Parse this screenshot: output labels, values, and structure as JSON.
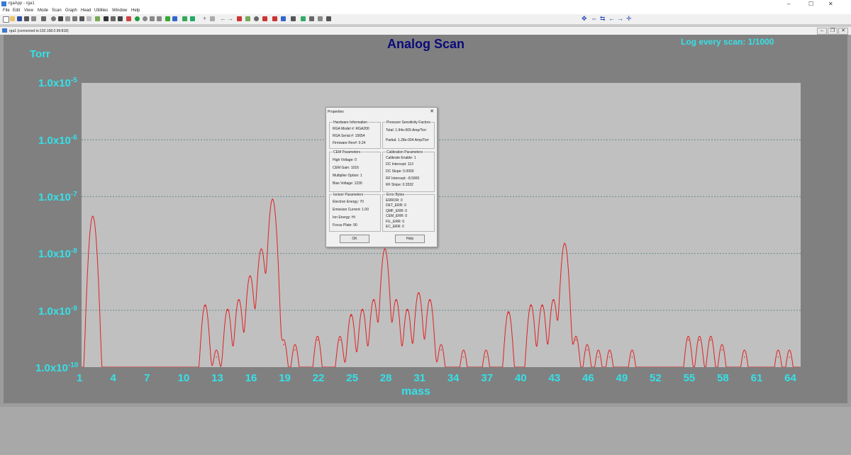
{
  "window": {
    "title": "rgaApp - rga1",
    "minimize": "–",
    "maximize": "☐",
    "close": "✕"
  },
  "menu": [
    "File",
    "Edit",
    "View",
    "Mode",
    "Scan",
    "Graph",
    "Head",
    "Utilities",
    "Window",
    "Help"
  ],
  "mdi_window": {
    "title": "rga1 (connected to:192.168.0.99:818)",
    "minimize": "–",
    "restore": "❐",
    "close": "✕"
  },
  "chart_data": {
    "type": "line",
    "title": "Analog Scan",
    "annotation": "Log every scan: 1/1000",
    "ylabel": "Torr",
    "xlabel": "mass",
    "yscale": "log",
    "ylim": [
      1e-10,
      1e-05
    ],
    "xlim": [
      1,
      65
    ],
    "grid": true,
    "line_color": "#e02020",
    "ytick_labels": [
      {
        "base": "1.0x10",
        "exp": "-5"
      },
      {
        "base": "1.0x10",
        "exp": "-6"
      },
      {
        "base": "1.0x10",
        "exp": "-7"
      },
      {
        "base": "1.0x10",
        "exp": "-8"
      },
      {
        "base": "1.0x10",
        "exp": "-9"
      },
      {
        "base": "1.0x10",
        "exp": "-10"
      }
    ],
    "xticks": [
      1,
      4,
      7,
      10,
      13,
      16,
      19,
      22,
      25,
      28,
      31,
      34,
      37,
      40,
      43,
      46,
      49,
      52,
      55,
      58,
      61,
      64
    ],
    "series": [
      {
        "peaks": [
          {
            "mass": 2,
            "pressure": 4.5e-08
          },
          {
            "mass": 12,
            "pressure": 1.2e-09
          },
          {
            "mass": 13,
            "pressure": 1.5e-10
          },
          {
            "mass": 14,
            "pressure": 1e-09
          },
          {
            "mass": 15,
            "pressure": 1.5e-09
          },
          {
            "mass": 16,
            "pressure": 4e-09
          },
          {
            "mass": 17,
            "pressure": 1.2e-08
          },
          {
            "mass": 18,
            "pressure": 9e-08
          },
          {
            "mass": 19,
            "pressure": 2.5e-10
          },
          {
            "mass": 20,
            "pressure": 2e-10
          },
          {
            "mass": 22,
            "pressure": 3e-10
          },
          {
            "mass": 24,
            "pressure": 3e-10
          },
          {
            "mass": 25,
            "pressure": 8e-10
          },
          {
            "mass": 26,
            "pressure": 1e-09
          },
          {
            "mass": 27,
            "pressure": 1.5e-09
          },
          {
            "mass": 28,
            "pressure": 1.2e-08
          },
          {
            "mass": 29,
            "pressure": 1.5e-09
          },
          {
            "mass": 30,
            "pressure": 1e-09
          },
          {
            "mass": 31,
            "pressure": 2e-09
          },
          {
            "mass": 32,
            "pressure": 1.5e-09
          },
          {
            "mass": 33,
            "pressure": 2e-10
          },
          {
            "mass": 35,
            "pressure": 1.5e-10
          },
          {
            "mass": 37,
            "pressure": 1.5e-10
          },
          {
            "mass": 39,
            "pressure": 9e-10
          },
          {
            "mass": 41,
            "pressure": 1.2e-09
          },
          {
            "mass": 42,
            "pressure": 1.2e-09
          },
          {
            "mass": 43,
            "pressure": 1.5e-09
          },
          {
            "mass": 44,
            "pressure": 1.5e-08
          },
          {
            "mass": 45,
            "pressure": 3e-10
          },
          {
            "mass": 46,
            "pressure": 2e-10
          },
          {
            "mass": 47,
            "pressure": 1.5e-10
          },
          {
            "mass": 48,
            "pressure": 1.5e-10
          },
          {
            "mass": 50,
            "pressure": 1.5e-10
          },
          {
            "mass": 55,
            "pressure": 3e-10
          },
          {
            "mass": 56,
            "pressure": 3e-10
          },
          {
            "mass": 57,
            "pressure": 3e-10
          },
          {
            "mass": 58,
            "pressure": 2e-10
          },
          {
            "mass": 60,
            "pressure": 1.5e-10
          },
          {
            "mass": 63,
            "pressure": 1.5e-10
          },
          {
            "mass": 64,
            "pressure": 1.5e-10
          }
        ]
      }
    ]
  },
  "dialog": {
    "title": "Properties",
    "close": "✕",
    "hardware": {
      "title": "Hardware Information",
      "model": "RGA Model #:   RGA200",
      "serial": "RGA Serial #:    15654",
      "firmware": "Firmware Rev#:  0.24"
    },
    "sensitivity": {
      "title": "Pressure Sensitivity Factors",
      "total": "Total: 1.94e-005 Amp/Torr",
      "partial": "Partial: 1.28e-004 Amp/Torr"
    },
    "cem": {
      "title": "CEM Parameters",
      "high_voltage": "High Voltage:   0",
      "gain": "CEM Gain:   1016",
      "multiplier": "Multiplier Option:   1",
      "bias": "Bias Voltage:   1230"
    },
    "calibration": {
      "title": "Calibration Parameters",
      "enable": "Calibrate Enable:   1",
      "dc_intercept": "DC Intercept:   113",
      "dc_slope": "DC Slope:   0.0000",
      "rf_intercept": "RF Intercept:   -8.5900",
      "rf_slope": "RF Slope:   0.3532"
    },
    "ionizer": {
      "title": "Ionizer Parameters",
      "electron_energy": "Electron Energy:   70",
      "emission_current": "Emission Current:   1.00",
      "ion_energy": "Ion Energy:   Hi",
      "focus_plate": "Focus Plate:   90"
    },
    "errors": {
      "title": "Error Bytes",
      "rows": [
        "ERROR:      0",
        "DET_ERR:   0",
        "QMF_ERR:   0",
        "CEM_ERR:   0",
        "FIL_ERR:    0",
        "EC_ERR:     0"
      ]
    },
    "ok_label": "OK",
    "help_label": "Help"
  }
}
